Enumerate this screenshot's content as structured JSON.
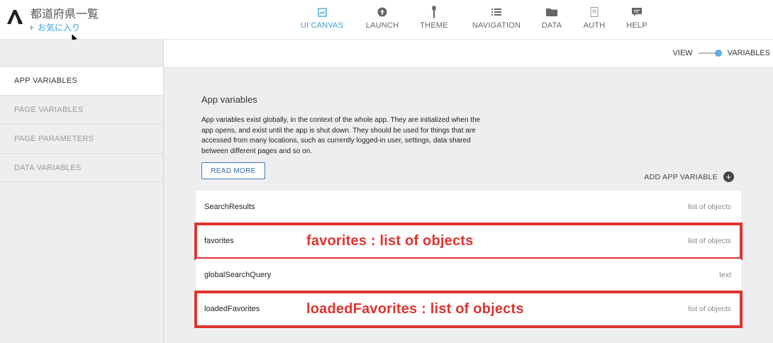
{
  "header": {
    "app_title": "都道府県一覧",
    "page_name": "お気に入り",
    "nav": [
      {
        "label": "UI CANVAS",
        "icon": "canvas-icon",
        "active": true
      },
      {
        "label": "LAUNCH",
        "icon": "launch-icon",
        "active": false
      },
      {
        "label": "THEME",
        "icon": "theme-icon",
        "active": false
      },
      {
        "label": "NAVIGATION",
        "icon": "navigation-icon",
        "active": false
      },
      {
        "label": "DATA",
        "icon": "folder-icon",
        "active": false
      },
      {
        "label": "AUTH",
        "icon": "auth-icon",
        "active": false
      },
      {
        "label": "HELP",
        "icon": "help-icon",
        "active": false
      }
    ]
  },
  "toolbar": {
    "view_label": "VIEW",
    "variables_label": "VARIABLES",
    "toggle_state": "VARIABLES"
  },
  "sidebar": {
    "items": [
      {
        "label": "APP VARIABLES",
        "active": true
      },
      {
        "label": "PAGE VARIABLES",
        "active": false
      },
      {
        "label": "PAGE PARAMETERS",
        "active": false
      },
      {
        "label": "DATA VARIABLES",
        "active": false
      }
    ]
  },
  "main": {
    "title": "App variables",
    "description": "App variables exist globally, in the context of the whole app. They are initialized when the app opens, and exist until the app is shut down. They should be used for things that are accessed from many locations, such as currently logged-in user, settings, data shared between different pages and so on.",
    "read_more_label": "READ MORE",
    "add_label": "ADD APP VARIABLE",
    "variables": [
      {
        "name": "SearchResults",
        "type": "list of objects",
        "annotation": ""
      },
      {
        "name": "favorites",
        "type": "list of objects",
        "annotation": "favorites : list of objects"
      },
      {
        "name": "globalSearchQuery",
        "type": "text",
        "annotation": ""
      },
      {
        "name": "loadedFavorites",
        "type": "list of objects",
        "annotation": "loadedFavorites : list of objects"
      }
    ]
  },
  "colors": {
    "accent": "#3aa0d8",
    "highlight": "#e0342f",
    "button_border": "#3a78b5"
  }
}
